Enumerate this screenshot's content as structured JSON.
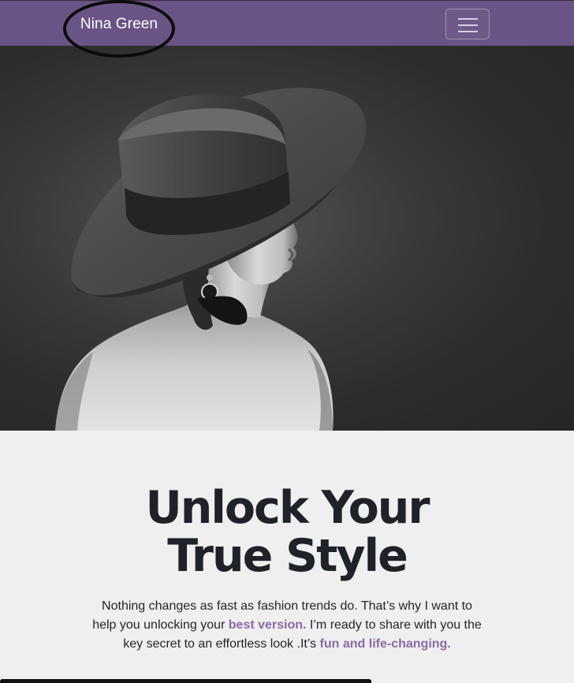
{
  "navbar": {
    "brand": "Nina Green",
    "toggler_icon": "hamburger-menu-icon"
  },
  "hero": {
    "image": "woman-in-wide-brim-hat-photo"
  },
  "main": {
    "headline_line1": "Unlock Your",
    "headline_line2": "True Style",
    "intro_part1": "Nothing changes as fast as fashion trends do. That’s why I want to help you unlocking your ",
    "intro_highlight1": "best version.",
    "intro_part2": " I’m ready to share with you the key secret to an effortless look .It’s ",
    "intro_highlight2": "fun and life-changing."
  },
  "colors": {
    "navbar_bg": "#6a5486",
    "accent": "#8b6aa6",
    "text": "#212529",
    "page_bg": "#efefef"
  }
}
